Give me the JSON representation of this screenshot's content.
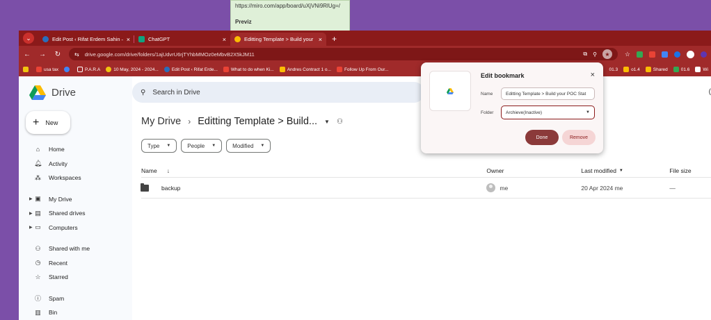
{
  "sticky": {
    "url": "https://miro.com/app/board/uXjVNi9RlUg=/",
    "heading": "Previz"
  },
  "tabs": [
    {
      "title": "Edit Post ‹ Rifat Erdem Sahin —",
      "color": "#2a6ebb"
    },
    {
      "title": "ChatGPT",
      "color": "#10a37f"
    },
    {
      "title": "Editting Template > Build your",
      "color": "#fbbc04"
    }
  ],
  "address": {
    "url": "drive.google.com/drive/folders/1ajUdvrU6rjTYhbMMOz0eMbvB2X5kJM11"
  },
  "bookmarks": [
    {
      "label": "",
      "color": "#f1c40f"
    },
    {
      "label": "usa tax",
      "color": "#ea4335"
    },
    {
      "label": "",
      "color": "#4285f4"
    },
    {
      "label": "P.A.R.A",
      "color": "#ffffff"
    },
    {
      "label": "10 May, 2024 - 2024...",
      "color": "#f1c40f"
    },
    {
      "label": "Edit Post ‹ Rifat Erde...",
      "color": "#2a6ebb"
    },
    {
      "label": "What to do when Ki...",
      "color": "#ea4335"
    },
    {
      "label": "Andres Contract 1 o...",
      "color": "#fbbc04"
    },
    {
      "label": "Follow Up From Our...",
      "color": "#ea4335"
    }
  ],
  "bookmarks_right": [
    {
      "label": "01.3"
    },
    {
      "label": "o1.4"
    },
    {
      "label": "Shared"
    },
    {
      "label": "01.6"
    },
    {
      "label": "Wi"
    }
  ],
  "drive": {
    "logo_text": "Drive",
    "new_label": "New",
    "search_placeholder": "Search in Drive",
    "nav": [
      {
        "label": "Home",
        "icon": "home-icon",
        "glyph": "⌂"
      },
      {
        "label": "Activity",
        "icon": "bell-icon",
        "glyph": "♫"
      },
      {
        "label": "Workspaces",
        "icon": "workspaces-icon",
        "glyph": "⁂"
      },
      {
        "label": "My Drive",
        "icon": "my-drive-icon",
        "glyph": "▣"
      },
      {
        "label": "Shared drives",
        "icon": "shared-drives-icon",
        "glyph": "▤"
      },
      {
        "label": "Computers",
        "icon": "computer-icon",
        "glyph": "▭"
      },
      {
        "label": "Shared with me",
        "icon": "people-icon",
        "glyph": "⚇"
      },
      {
        "label": "Recent",
        "icon": "clock-icon",
        "glyph": "◷"
      },
      {
        "label": "Starred",
        "icon": "star-icon",
        "glyph": "☆"
      },
      {
        "label": "Spam",
        "icon": "spam-icon",
        "glyph": "ⓘ"
      },
      {
        "label": "Bin",
        "icon": "bin-icon",
        "glyph": "▥"
      }
    ],
    "breadcrumb_root": "My Drive",
    "breadcrumb_current": "Editting Template > Build...",
    "filters": [
      "Type",
      "People",
      "Modified"
    ],
    "columns": {
      "name": "Name",
      "owner": "Owner",
      "modified": "Last modified",
      "size": "File size"
    },
    "rows": [
      {
        "name": "backup",
        "owner": "me",
        "modified": "20 Apr 2024 me",
        "size": "—"
      }
    ]
  },
  "popup": {
    "title": "Edit bookmark",
    "name_label": "Name",
    "name_value": "Editting Template > Build your POC Stat",
    "folder_label": "Folder",
    "folder_value": "Archieve(Inactive)",
    "done_label": "Done",
    "remove_label": "Remove"
  }
}
